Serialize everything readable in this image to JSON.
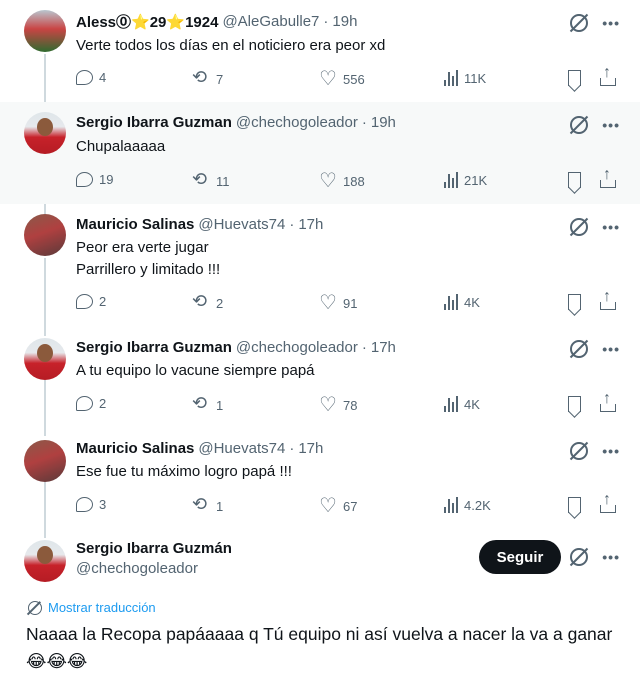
{
  "tweets": [
    {
      "name": "Aless⓪⭐29⭐1924",
      "handle": "@AleGabulle7",
      "time": "19h",
      "lines": [
        "Verte todos los días en el noticiero era peor xd"
      ],
      "replies": "4",
      "reposts": "7",
      "likes": "556",
      "views": "11K"
    },
    {
      "name": "Sergio Ibarra Guzman",
      "handle": "@chechogoleador",
      "time": "19h",
      "lines": [
        "Chupalaaaaa"
      ],
      "replies": "19",
      "reposts": "11",
      "likes": "188",
      "views": "21K"
    },
    {
      "name": "Mauricio Salinas",
      "handle": "@Huevats74",
      "time": "17h",
      "lines": [
        "Peor era verte jugar",
        "Parrillero y limitado !!!"
      ],
      "replies": "2",
      "reposts": "2",
      "likes": "91",
      "views": "4K"
    },
    {
      "name": "Sergio Ibarra Guzman",
      "handle": "@chechogoleador",
      "time": "17h",
      "lines": [
        "A tu equipo lo vacune siempre papá"
      ],
      "replies": "2",
      "reposts": "1",
      "likes": "78",
      "views": "4K"
    },
    {
      "name": "Mauricio Salinas",
      "handle": "@Huevats74",
      "time": "17h",
      "lines": [
        "Ese fue tu máximo logro papá !!!"
      ],
      "replies": "3",
      "reposts": "1",
      "likes": "67",
      "views": "4.2K"
    }
  ],
  "main": {
    "name": "Sergio Ibarra Guzmán",
    "handle": "@chechogoleador",
    "follow_label": "Seguir",
    "translate_label": "Mostrar traducción",
    "text": "Naaaa la Recopa papáaaaa q Tú equipo ni así vuelva a nacer la va a ganar😂😂😂"
  },
  "separator": "·",
  "icons": {
    "reply": "reply-icon",
    "repost": "repost-icon",
    "like": "like-icon",
    "views": "views-icon",
    "bookmark": "bookmark-icon",
    "share": "share-icon",
    "grok": "grok-icon",
    "more": "more-icon"
  }
}
